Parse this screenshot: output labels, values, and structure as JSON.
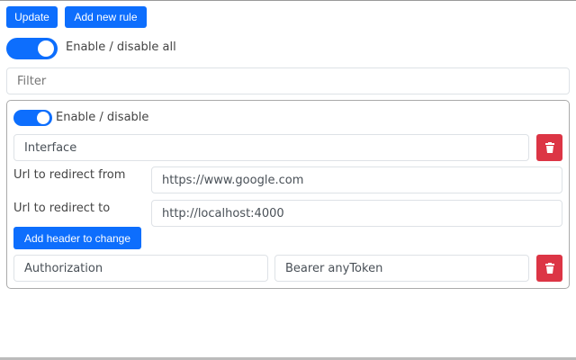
{
  "toolbar": {
    "update_label": "Update",
    "add_rule_label": "Add new rule"
  },
  "global_toggle": {
    "label": "Enable / disable all",
    "enabled": true
  },
  "filter": {
    "placeholder": "Filter",
    "value": ""
  },
  "rule": {
    "toggle": {
      "label": "Enable / disable",
      "enabled": true
    },
    "name": "Interface",
    "from_label": "Url to redirect from",
    "from_value": "https://www.google.com",
    "to_label": "Url to redirect to",
    "to_value": "http://localhost:4000",
    "add_header_label": "Add header to change",
    "headers": [
      {
        "name": "Authorization",
        "value": "Bearer anyToken"
      }
    ]
  },
  "colors": {
    "primary": "#0d6efd",
    "danger": "#dc3545"
  }
}
